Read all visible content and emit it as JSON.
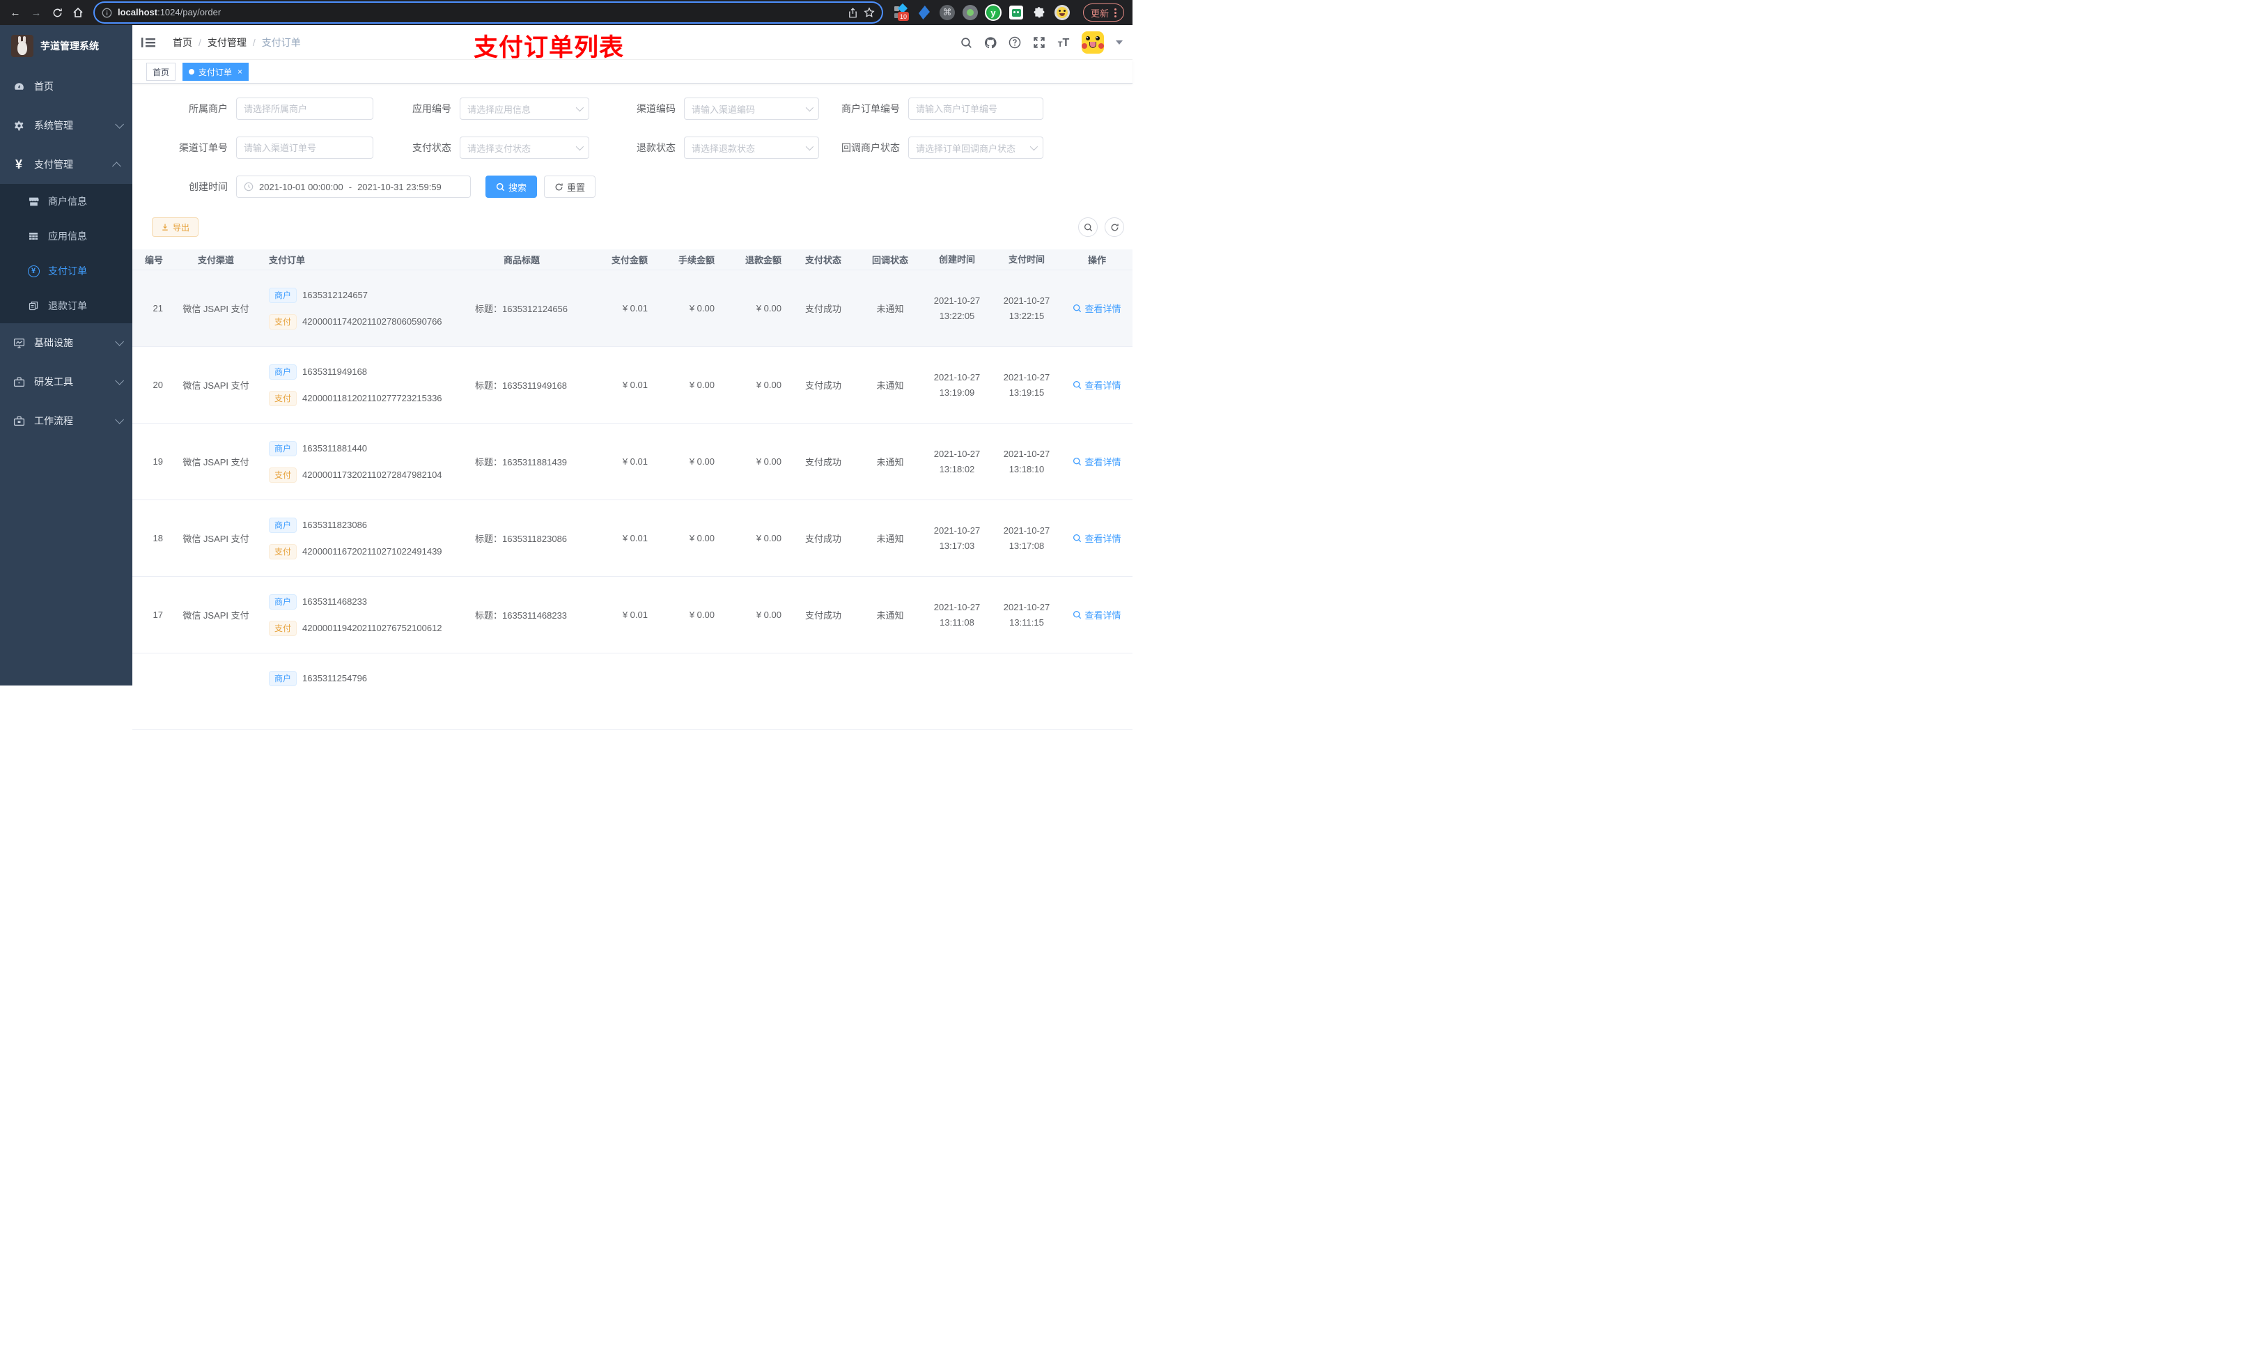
{
  "browser": {
    "url_host": "localhost",
    "url_path": ":1024/pay/order",
    "update_label": "更新",
    "extension_badge": "10",
    "ext_y_label": "y",
    "cmd_symbol": "⌘",
    "icons": [
      "back-icon",
      "forward-icon",
      "reload-icon",
      "home-icon",
      "info-icon",
      "share-icon",
      "star-icon",
      "extensions-icons",
      "profile-avatar",
      "update-button"
    ]
  },
  "sidebar": {
    "logo_title": "芋道管理系统",
    "menu": [
      {
        "label": "首页",
        "icon": "dashboard-icon",
        "level": 1
      },
      {
        "label": "系统管理",
        "icon": "gear-icon",
        "level": 1,
        "arrow": "down"
      },
      {
        "label": "支付管理",
        "icon": "yen-icon",
        "level": 1,
        "arrow": "up"
      },
      {
        "label": "商户信息",
        "icon": "shop-icon",
        "level": 2
      },
      {
        "label": "应用信息",
        "icon": "apps-icon",
        "level": 2
      },
      {
        "label": "支付订单",
        "icon": "pay-order-icon",
        "level": 2,
        "active": true
      },
      {
        "label": "退款订单",
        "icon": "refund-order-icon",
        "level": 2
      },
      {
        "label": "基础设施",
        "icon": "infrastructure-icon",
        "level": 1,
        "arrow": "down"
      },
      {
        "label": "研发工具",
        "icon": "devtools-icon",
        "level": 1,
        "arrow": "down"
      },
      {
        "label": "工作流程",
        "icon": "workflow-icon",
        "level": 1,
        "arrow": "down"
      }
    ]
  },
  "header": {
    "breadcrumb": [
      "首页",
      "支付管理",
      "支付订单"
    ],
    "separator": "/",
    "overlay_title": "支付订单列表",
    "tabs": [
      {
        "label": "首页",
        "active": false
      },
      {
        "label": "支付订单",
        "active": true,
        "closable": true
      }
    ],
    "close_symbol": "×",
    "icons": [
      "fold-icon",
      "search-icon",
      "github-icon",
      "help-icon",
      "fullscreen-icon",
      "font-size-icon",
      "avatar",
      "caret-down-icon"
    ]
  },
  "filters": {
    "fields": [
      {
        "label": "所属商户",
        "placeholder": "请选择所属商户",
        "type": "input"
      },
      {
        "label": "应用编号",
        "placeholder": "请选择应用信息",
        "type": "select"
      },
      {
        "label": "渠道编码",
        "placeholder": "请输入渠道编码",
        "type": "select"
      },
      {
        "label": "商户订单编号",
        "placeholder": "请输入商户订单编号",
        "type": "input"
      },
      {
        "label": "渠道订单号",
        "placeholder": "请输入渠道订单号",
        "type": "input"
      },
      {
        "label": "支付状态",
        "placeholder": "请选择支付状态",
        "type": "select"
      },
      {
        "label": "退款状态",
        "placeholder": "请选择退款状态",
        "type": "select"
      },
      {
        "label": "回调商户状态",
        "placeholder": "请选择订单回调商户状态",
        "type": "select"
      }
    ],
    "date": {
      "label": "创建时间",
      "start": "2021-10-01 00:00:00",
      "separator": "-",
      "end": "2021-10-31 23:59:59"
    },
    "search_label": "搜索",
    "reset_label": "重置"
  },
  "toolbar": {
    "export_label": "导出"
  },
  "table": {
    "columns": [
      "编号",
      "支付渠道",
      "支付订单",
      "商品标题",
      "支付金额",
      "手续金额",
      "退款金额",
      "支付状态",
      "回调状态",
      "创建时间",
      "支付时间",
      "操作"
    ],
    "tag_labels": {
      "merchant": "商户",
      "pay": "支付"
    },
    "title_prefix": "标题：",
    "rows": [
      {
        "id": "21",
        "channel": "微信 JSAPI 支付",
        "merchant_no": "1635312124657",
        "pay_no": "4200001174202110278060590766",
        "title": "1635312124656",
        "pay_amount": "¥ 0.01",
        "fee_amount": "¥ 0.00",
        "refund_amount": "¥ 0.00",
        "pay_status": "支付成功",
        "notify_status": "未通知",
        "create_date": "2021-10-27",
        "create_time": "13:22:05",
        "pay_date": "2021-10-27",
        "pay_time": "13:22:15",
        "action": "查看详情",
        "highlight": true
      },
      {
        "id": "20",
        "channel": "微信 JSAPI 支付",
        "merchant_no": "1635311949168",
        "pay_no": "4200001181202110277723215336",
        "title": "1635311949168",
        "pay_amount": "¥ 0.01",
        "fee_amount": "¥ 0.00",
        "refund_amount": "¥ 0.00",
        "pay_status": "支付成功",
        "notify_status": "未通知",
        "create_date": "2021-10-27",
        "create_time": "13:19:09",
        "pay_date": "2021-10-27",
        "pay_time": "13:19:15",
        "action": "查看详情",
        "highlight": false
      },
      {
        "id": "19",
        "channel": "微信 JSAPI 支付",
        "merchant_no": "1635311881440",
        "pay_no": "4200001173202110272847982104",
        "title": "1635311881439",
        "pay_amount": "¥ 0.01",
        "fee_amount": "¥ 0.00",
        "refund_amount": "¥ 0.00",
        "pay_status": "支付成功",
        "notify_status": "未通知",
        "create_date": "2021-10-27",
        "create_time": "13:18:02",
        "pay_date": "2021-10-27",
        "pay_time": "13:18:10",
        "action": "查看详情",
        "highlight": false
      },
      {
        "id": "18",
        "channel": "微信 JSAPI 支付",
        "merchant_no": "1635311823086",
        "pay_no": "4200001167202110271022491439",
        "title": "1635311823086",
        "pay_amount": "¥ 0.01",
        "fee_amount": "¥ 0.00",
        "refund_amount": "¥ 0.00",
        "pay_status": "支付成功",
        "notify_status": "未通知",
        "create_date": "2021-10-27",
        "create_time": "13:17:03",
        "pay_date": "2021-10-27",
        "pay_time": "13:17:08",
        "action": "查看详情",
        "highlight": false
      },
      {
        "id": "17",
        "channel": "微信 JSAPI 支付",
        "merchant_no": "1635311468233",
        "pay_no": "4200001194202110276752100612",
        "title": "1635311468233",
        "pay_amount": "¥ 0.01",
        "fee_amount": "¥ 0.00",
        "refund_amount": "¥ 0.00",
        "pay_status": "支付成功",
        "notify_status": "未通知",
        "create_date": "2021-10-27",
        "create_time": "13:11:08",
        "pay_date": "2021-10-27",
        "pay_time": "13:11:15",
        "action": "查看详情",
        "highlight": false
      },
      {
        "id": "",
        "channel": "",
        "merchant_no": "1635311254796",
        "pay_no": "",
        "title": "",
        "pay_amount": "",
        "fee_amount": "",
        "refund_amount": "",
        "pay_status": "",
        "notify_status": "",
        "create_date": "",
        "create_time": "",
        "pay_date": "",
        "pay_time": "",
        "action": "",
        "highlight": false
      }
    ]
  },
  "colors": {
    "accent": "#409EFF",
    "warning": "#E6A23C",
    "overlay_red": "#FF0000",
    "sidebar_bg": "#304156",
    "submenu_bg": "#1F2D3D"
  }
}
